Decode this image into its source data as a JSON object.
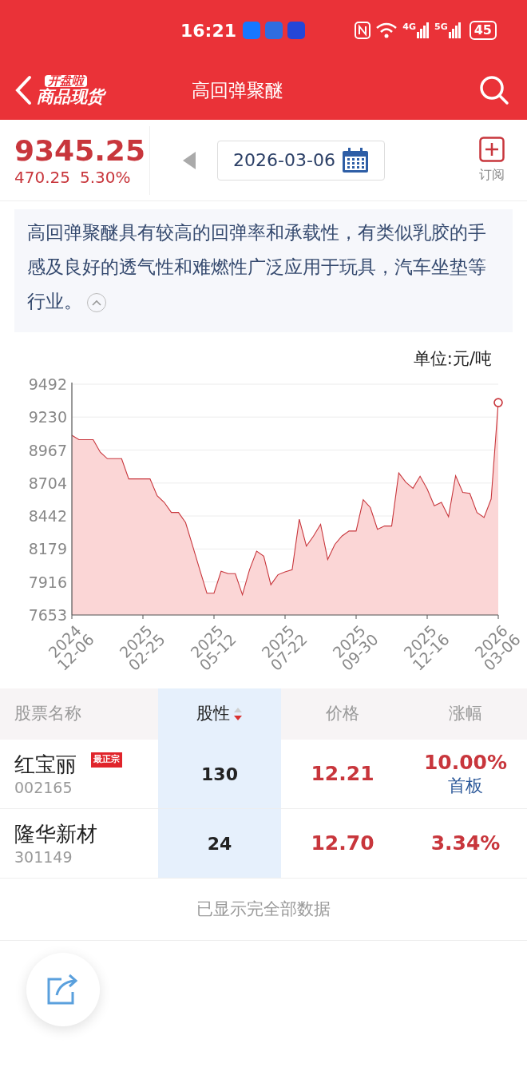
{
  "status_bar": {
    "time": "16:21",
    "network_labels": [
      "4G",
      "5G"
    ],
    "battery": "45"
  },
  "header": {
    "logo_top": "开盘啦",
    "logo_bottom": "商品现货",
    "title": "高回弹聚醚"
  },
  "quote": {
    "price": "9345.25",
    "change": "470.25",
    "change_pct": "5.30%",
    "date": "2026-03-06",
    "subscribe": "订阅"
  },
  "description": {
    "text": "高回弹聚醚具有较高的回弹率和承载性，有类似乳胶的手感及良好的透气性和难燃性广泛应用于玩具，汽车坐垫等行业。",
    "expanded": true
  },
  "chart": {
    "unit": "单位:元/吨",
    "chart_data": {
      "type": "area",
      "categories": [
        "2024 12-06",
        null,
        null,
        null,
        null,
        null,
        null,
        null,
        null,
        null,
        "2025 02-25",
        null,
        null,
        null,
        null,
        null,
        null,
        null,
        null,
        null,
        "2025 05-12",
        null,
        null,
        null,
        null,
        null,
        null,
        null,
        null,
        null,
        "2025 07-22",
        null,
        null,
        null,
        null,
        null,
        null,
        null,
        null,
        null,
        "2025 09-30",
        null,
        null,
        null,
        null,
        null,
        null,
        null,
        null,
        null,
        "2025 12-16",
        null,
        null,
        null,
        null,
        null,
        null,
        null,
        null,
        null,
        "2026 03-06"
      ],
      "series": [
        {
          "color": "#c8363c",
          "values": [
            9085,
            9050,
            9050,
            9050,
            8950,
            8898,
            8898,
            8898,
            8737,
            8737,
            8737,
            8737,
            8603,
            8550,
            8470,
            8470,
            8389,
            8202,
            8014,
            7827,
            7827,
            8001,
            7982,
            7982,
            7814,
            8014,
            8162,
            8122,
            7894,
            7974,
            7996,
            8014,
            8416,
            8202,
            8282,
            8376,
            8095,
            8215,
            8282,
            8322,
            8322,
            8571,
            8509,
            8336,
            8362,
            8362,
            8785,
            8710,
            8662,
            8758,
            8657,
            8523,
            8550,
            8435,
            8763,
            8630,
            8622,
            8470,
            8430,
            8577,
            9345
          ]
        }
      ],
      "ylim": [
        7653,
        9492
      ],
      "grid": true,
      "yticks": [
        7653,
        7916,
        8179,
        8442,
        8704,
        8967,
        9230,
        9492
      ]
    }
  },
  "table": {
    "columns": [
      {
        "label": "股票名称",
        "selected": false,
        "sorted": false
      },
      {
        "label": "股性",
        "selected": true,
        "sorted": true
      },
      {
        "label": "价格",
        "selected": false,
        "sorted": false
      },
      {
        "label": "涨幅",
        "selected": false,
        "sorted": false
      }
    ],
    "rows": [
      {
        "name": "红宝丽",
        "code": "002165",
        "tag": "最正宗",
        "score": "130",
        "price": "12.21",
        "change": "10.00%",
        "note": "首板"
      },
      {
        "name": "隆华新材",
        "code": "301149",
        "score": "24",
        "price": "12.70",
        "change": "3.34%"
      }
    ]
  },
  "footer": "已显示完全部数据"
}
